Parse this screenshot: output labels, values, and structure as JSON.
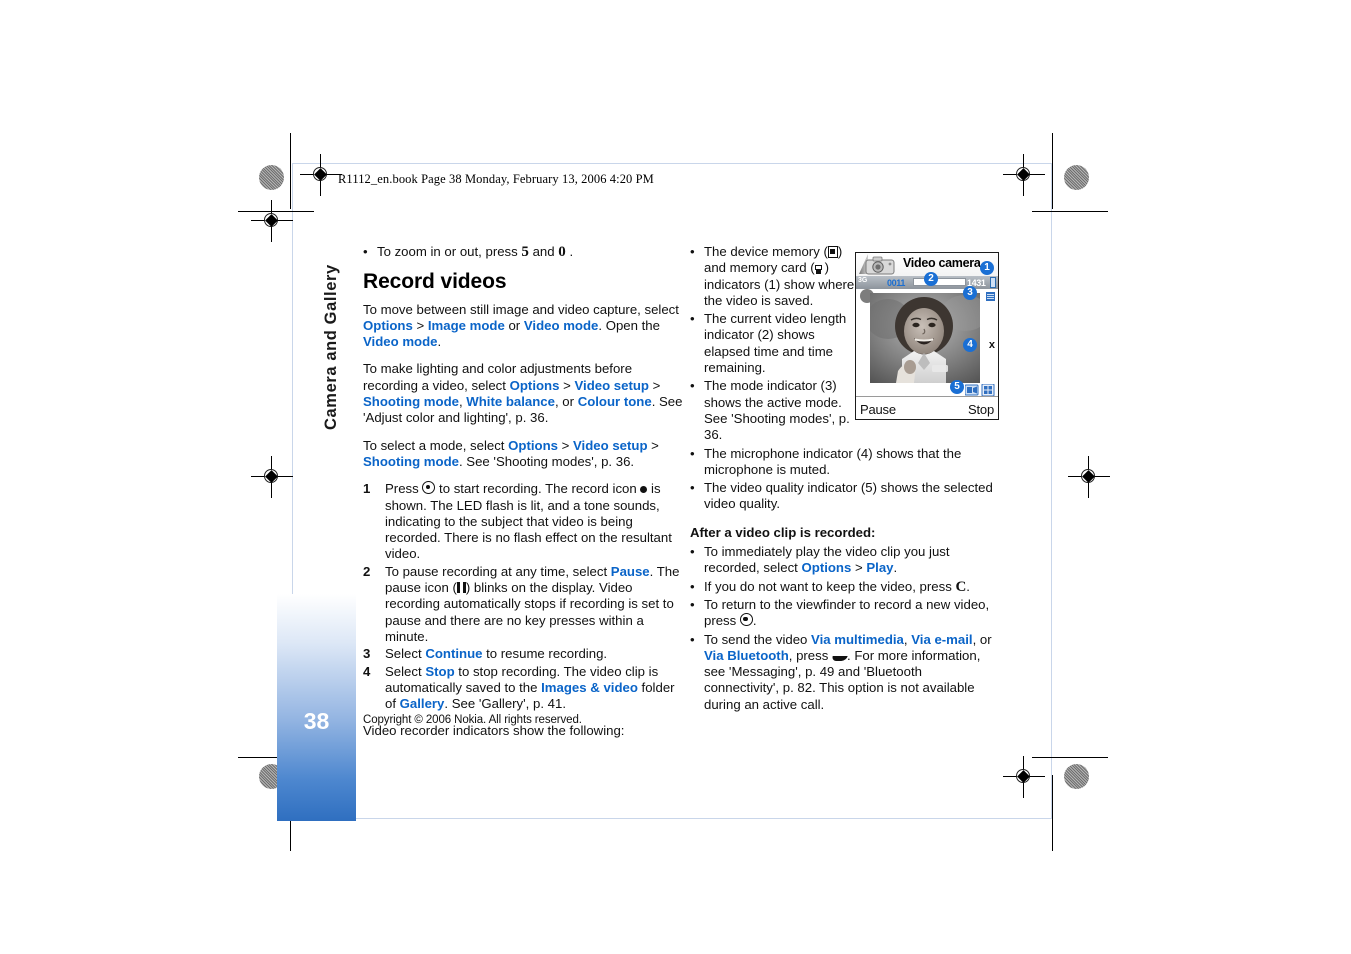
{
  "document": {
    "running_header": "R1112_en.book  Page 38  Monday, February 13, 2006  4:20 PM",
    "chapter_title": "Camera and Gallery",
    "page_number": "38",
    "copyright": "Copyright © 2006 Nokia. All rights reserved.",
    "accent_blue": "#0a64c8",
    "tab_blue": "#2f6fc0"
  },
  "column_left": {
    "zoom_bullet": {
      "bullet": "•",
      "text_before": "To zoom in or out, press",
      "key_1": "5",
      "text_mid": "and",
      "key_2": "0",
      "text_after": "."
    },
    "heading": "Record videos",
    "para_1": {
      "t1": "To move between still image and video capture, select ",
      "l1": "Options",
      "t2": " > ",
      "l2": "Image mode",
      "t3": " or ",
      "l3": "Video mode",
      "t4": ". Open the ",
      "l4": "Video mode",
      "t5": "."
    },
    "para_2": {
      "t1": "To make lighting and color adjustments before recording a video, select ",
      "l1": "Options",
      "t2": " > ",
      "l2": "Video setup",
      "t3": " > ",
      "l3": "Shooting mode",
      "t4": ", ",
      "l4": "White balance",
      "t5": ", or ",
      "l5": "Colour tone",
      "t6": ". See 'Adjust color and lighting', p. 36."
    },
    "para_3": {
      "t1": "To select a mode, select ",
      "l1": "Options",
      "t2": " > ",
      "l2": "Video setup",
      "t3": " > ",
      "l3": "Shooting mode",
      "t4": ". See 'Shooting modes', p. 36."
    },
    "steps": [
      {
        "number": "1",
        "t1": "Press ",
        "icon1": "navi-key-icon",
        "t2": " to start recording. The record icon ",
        "icon2": "record-dot-icon",
        "t3": " is shown. The LED flash is lit, and a tone sounds, indicating to the subject that video is being recorded. There is no flash effect on the resultant video."
      },
      {
        "number": "2",
        "t1": "To pause recording at any time, select ",
        "l1": "Pause",
        "t2": ". The pause icon (",
        "icon1": "pause-bars-icon",
        "t3": ") blinks on the display. Video recording automatically stops if recording is set to pause and there are no key presses within a minute."
      },
      {
        "number": "3",
        "t1": "Select ",
        "l1": "Continue",
        "t2": " to resume recording."
      },
      {
        "number": "4",
        "t1": "Select ",
        "l1": "Stop",
        "t2": " to stop recording. The video clip is automatically saved to the ",
        "l2": "Images & video",
        "t3": " folder of ",
        "l3": "Gallery",
        "t4": ". See 'Gallery', p. 41."
      }
    ],
    "closing": "Video recorder indicators show the following:"
  },
  "column_right": {
    "indicator_bullets": [
      {
        "t1": "The device memory (",
        "icon1": "device-memory-icon",
        "t2": ") and memory card (",
        "icon2": "memory-card-icon",
        "t3": ") indicators (1) show where the video is saved."
      },
      {
        "t1": "The current video length indicator (2) shows elapsed time and time remaining."
      },
      {
        "t1": "The mode indicator (3) shows the active mode. See 'Shooting modes', p. 36."
      },
      {
        "t1": "The microphone indicator (4) shows that the microphone is muted."
      },
      {
        "t1": "The video quality indicator (5) shows the selected video quality."
      }
    ],
    "after_heading": "After a video clip is recorded:",
    "after_bullets": [
      {
        "t1": "To immediately play the video clip you just recorded, select ",
        "l1": "Options",
        "t2": " > ",
        "l2": "Play",
        "t3": "."
      },
      {
        "t1": "If you do not want to keep the video, press ",
        "key": "C",
        "t2": "."
      },
      {
        "t1": "To return to the viewfinder to record a new video, press ",
        "icon1": "navi-key-icon",
        "t2": "."
      },
      {
        "t1": "To send the video ",
        "l1": "Via multimedia",
        "t2": ", ",
        "l2": "Via e-mail",
        "t3": ", or ",
        "l3": "Via Bluetooth",
        "t4": ", press ",
        "icon1": "call-key-icon",
        "t5": ". For more information, see 'Messaging', p. 49 and 'Bluetooth connectivity', p. 82. This option is not available during an active call."
      }
    ]
  },
  "phone_screenshot": {
    "title": "Video camera",
    "network": "3G",
    "elapsed_time": "0011",
    "time_remaining": "1431",
    "softkey_left": "Pause",
    "softkey_right": "Stop",
    "callouts": [
      "1",
      "2",
      "3",
      "4",
      "5"
    ],
    "mic_muted_glyph": "x",
    "icons": {
      "camera": "camera-icon",
      "signal": "signal-bars-icon",
      "battery": "battery-icon",
      "mode": "mode-indicator-icon",
      "quality": "video-quality-icon"
    }
  }
}
